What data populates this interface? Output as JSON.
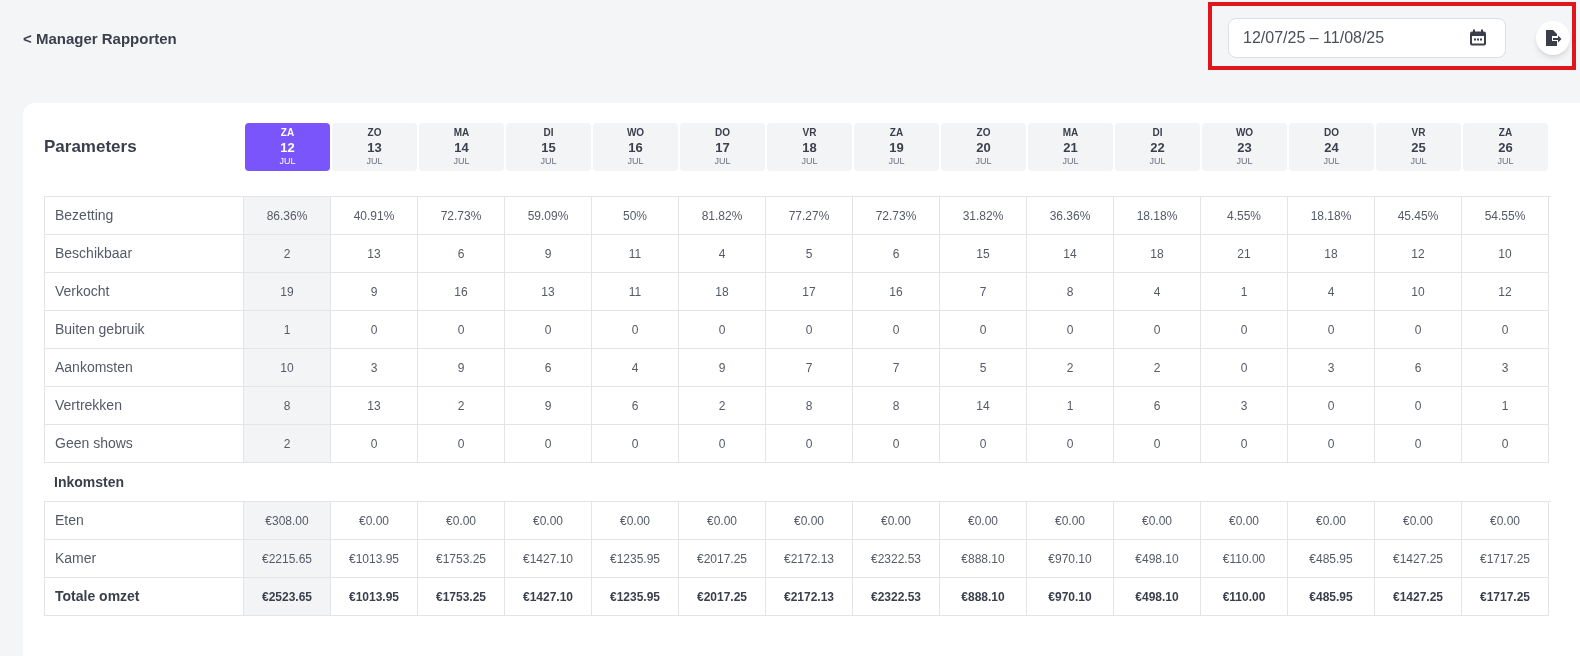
{
  "header": {
    "back_link": "< Manager Rapporten"
  },
  "date_range": {
    "value": "12/07/25 – 11/08/25",
    "highlighted": true
  },
  "table": {
    "title": "Parameters",
    "days": [
      {
        "weekday": "ZA",
        "day": "12",
        "month": "JUL",
        "selected": true
      },
      {
        "weekday": "ZO",
        "day": "13",
        "month": "JUL",
        "selected": false
      },
      {
        "weekday": "MA",
        "day": "14",
        "month": "JUL",
        "selected": false
      },
      {
        "weekday": "DI",
        "day": "15",
        "month": "JUL",
        "selected": false
      },
      {
        "weekday": "WO",
        "day": "16",
        "month": "JUL",
        "selected": false
      },
      {
        "weekday": "DO",
        "day": "17",
        "month": "JUL",
        "selected": false
      },
      {
        "weekday": "VR",
        "day": "18",
        "month": "JUL",
        "selected": false
      },
      {
        "weekday": "ZA",
        "day": "19",
        "month": "JUL",
        "selected": false
      },
      {
        "weekday": "ZO",
        "day": "20",
        "month": "JUL",
        "selected": false
      },
      {
        "weekday": "MA",
        "day": "21",
        "month": "JUL",
        "selected": false
      },
      {
        "weekday": "DI",
        "day": "22",
        "month": "JUL",
        "selected": false
      },
      {
        "weekday": "WO",
        "day": "23",
        "month": "JUL",
        "selected": false
      },
      {
        "weekday": "DO",
        "day": "24",
        "month": "JUL",
        "selected": false
      },
      {
        "weekday": "VR",
        "day": "25",
        "month": "JUL",
        "selected": false
      },
      {
        "weekday": "ZA",
        "day": "26",
        "month": "JUL",
        "selected": false
      }
    ],
    "sections": [
      {
        "rows": [
          {
            "kind": "value",
            "label": "Bezetting",
            "values": [
              "86.36%",
              "40.91%",
              "72.73%",
              "59.09%",
              "50%",
              "81.82%",
              "77.27%",
              "72.73%",
              "31.82%",
              "36.36%",
              "18.18%",
              "4.55%",
              "18.18%",
              "45.45%",
              "54.55%"
            ]
          },
          {
            "kind": "value",
            "label": "Beschikbaar",
            "values": [
              "2",
              "13",
              "6",
              "9",
              "11",
              "4",
              "5",
              "6",
              "15",
              "14",
              "18",
              "21",
              "18",
              "12",
              "10"
            ]
          },
          {
            "kind": "value",
            "label": "Verkocht",
            "values": [
              "19",
              "9",
              "16",
              "13",
              "11",
              "18",
              "17",
              "16",
              "7",
              "8",
              "4",
              "1",
              "4",
              "10",
              "12"
            ]
          },
          {
            "kind": "value",
            "label": "Buiten gebruik",
            "values": [
              "1",
              "0",
              "0",
              "0",
              "0",
              "0",
              "0",
              "0",
              "0",
              "0",
              "0",
              "0",
              "0",
              "0",
              "0"
            ]
          },
          {
            "kind": "value",
            "label": "Aankomsten",
            "values": [
              "10",
              "3",
              "9",
              "6",
              "4",
              "9",
              "7",
              "7",
              "5",
              "2",
              "2",
              "0",
              "3",
              "6",
              "3"
            ]
          },
          {
            "kind": "value",
            "label": "Vertrekken",
            "values": [
              "8",
              "13",
              "2",
              "9",
              "6",
              "2",
              "8",
              "8",
              "14",
              "1",
              "6",
              "3",
              "0",
              "0",
              "1"
            ]
          },
          {
            "kind": "value",
            "label": "Geen shows",
            "values": [
              "2",
              "0",
              "0",
              "0",
              "0",
              "0",
              "0",
              "0",
              "0",
              "0",
              "0",
              "0",
              "0",
              "0",
              "0"
            ]
          }
        ]
      },
      {
        "title": "Inkomsten",
        "rows": [
          {
            "kind": "value",
            "label": "Eten",
            "values": [
              "€308.00",
              "€0.00",
              "€0.00",
              "€0.00",
              "€0.00",
              "€0.00",
              "€0.00",
              "€0.00",
              "€0.00",
              "€0.00",
              "€0.00",
              "€0.00",
              "€0.00",
              "€0.00",
              "€0.00"
            ]
          },
          {
            "kind": "value",
            "label": "Kamer",
            "values": [
              "€2215.65",
              "€1013.95",
              "€1753.25",
              "€1427.10",
              "€1235.95",
              "€2017.25",
              "€2172.13",
              "€2322.53",
              "€888.10",
              "€970.10",
              "€498.10",
              "€110.00",
              "€485.95",
              "€1427.25",
              "€1717.25"
            ]
          },
          {
            "kind": "total",
            "label": "Totale omzet",
            "values": [
              "€2523.65",
              "€1013.95",
              "€1753.25",
              "€1427.10",
              "€1235.95",
              "€2017.25",
              "€2172.13",
              "€2322.53",
              "€888.10",
              "€970.10",
              "€498.10",
              "€110.00",
              "€485.95",
              "€1427.25",
              "€1717.25"
            ]
          }
        ]
      }
    ]
  }
}
